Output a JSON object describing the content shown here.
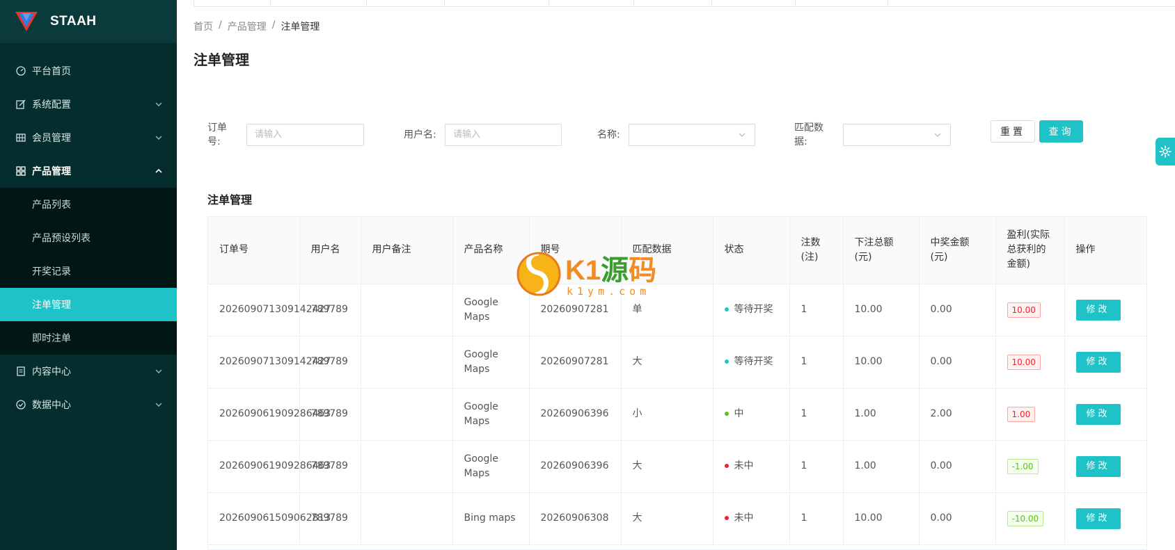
{
  "brand": {
    "name": "STAAH"
  },
  "sidebar": {
    "items": [
      {
        "label": "平台首页",
        "icon": "dashboard-icon"
      },
      {
        "label": "系统配置",
        "icon": "edit-icon"
      },
      {
        "label": "会员管理",
        "icon": "table-icon"
      },
      {
        "label": "产品管理",
        "icon": "grid-icon"
      },
      {
        "label": "内容中心",
        "icon": "document-icon"
      },
      {
        "label": "数据中心",
        "icon": "check-circle-icon"
      }
    ],
    "submenu": [
      {
        "label": "产品列表"
      },
      {
        "label": "产品预设列表"
      },
      {
        "label": "开奖记录"
      },
      {
        "label": "注单管理"
      },
      {
        "label": "即时注单"
      }
    ]
  },
  "breadcrumb": {
    "home": "首页",
    "parent": "产品管理",
    "current": "注单管理"
  },
  "page_title": "注单管理",
  "filters": {
    "order_label": "订单号:",
    "order_placeholder": "请输入",
    "user_label": "用户名:",
    "user_placeholder": "请输入",
    "name_label": "名称:",
    "match_label": "匹配数据:",
    "reset": "重置",
    "query": "查询"
  },
  "section_title": "注单管理",
  "table": {
    "columns": [
      "订单号",
      "用户名",
      "用户备注",
      "产品名称",
      "期号",
      "匹配数据",
      "状态",
      "注数(注)",
      "下注总额(元)",
      "中奖金额(元)",
      "盈利(实际总获利的金额)",
      "操作"
    ],
    "rows": [
      {
        "order": "202609071309142427",
        "user": "789789",
        "note": "",
        "product": "Google Maps",
        "issue": "20260907281",
        "match": "单",
        "status": "等待开奖",
        "status_color": "#1fc2c7",
        "count": "1",
        "total": "10.00",
        "win": "0.00",
        "profit": "10.00",
        "profit_type": "neg",
        "action": "修改"
      },
      {
        "order": "202609071309142427",
        "user": "789789",
        "note": "",
        "product": "Google Maps",
        "issue": "20260907281",
        "match": "大",
        "status": "等待开奖",
        "status_color": "#1fc2c7",
        "count": "1",
        "total": "10.00",
        "win": "0.00",
        "profit": "10.00",
        "profit_type": "neg",
        "action": "修改"
      },
      {
        "order": "202609061909286463",
        "user": "789789",
        "note": "",
        "product": "Google Maps",
        "issue": "20260906396",
        "match": "小",
        "status": "中",
        "status_color": "#52c41a",
        "count": "1",
        "total": "1.00",
        "win": "2.00",
        "profit": "1.00",
        "profit_type": "neg",
        "action": "修改"
      },
      {
        "order": "202609061909286463",
        "user": "789789",
        "note": "",
        "product": "Google Maps",
        "issue": "20260906396",
        "match": "大",
        "status": "未中",
        "status_color": "#f5222d",
        "count": "1",
        "total": "1.00",
        "win": "0.00",
        "profit": "-1.00",
        "profit_type": "pos",
        "action": "修改"
      },
      {
        "order": "202609061509062813",
        "user": "789789",
        "note": "",
        "product": "Bing maps",
        "issue": "20260906308",
        "match": "大",
        "status": "未中",
        "status_color": "#f5222d",
        "count": "1",
        "total": "10.00",
        "win": "0.00",
        "profit": "-10.00",
        "profit_type": "pos",
        "action": "修改"
      }
    ]
  },
  "watermark": {
    "main": "K1源码",
    "sub": "k1ym.com"
  }
}
